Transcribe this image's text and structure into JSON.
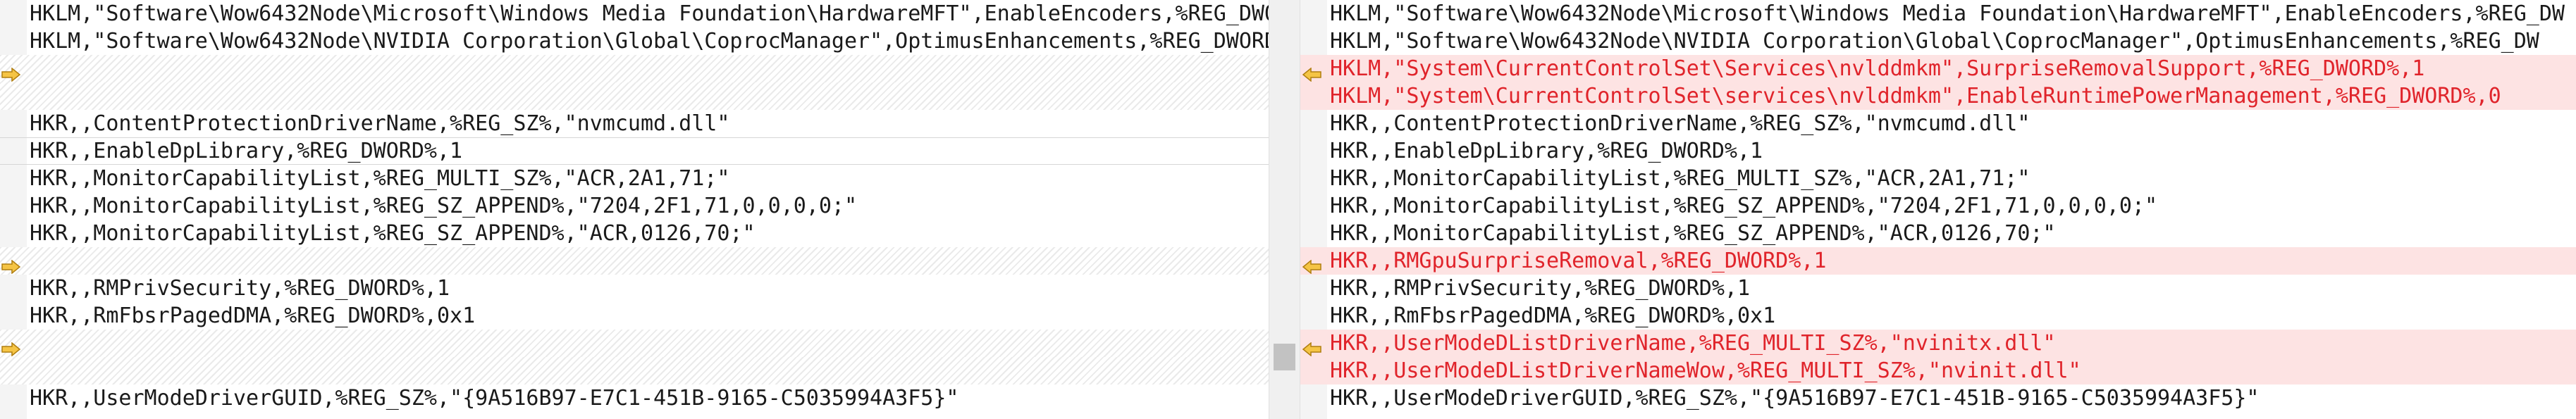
{
  "left_pane": {
    "lines": [
      {
        "kind": "text",
        "text": "HKLM,\"Software\\Wow6432Node\\Microsoft\\Windows Media Foundation\\HardwareMFT\",EnableEncoders,%REG_DWO"
      },
      {
        "kind": "text",
        "text": "HKLM,\"Software\\Wow6432Node\\NVIDIA Corporation\\Global\\CoprocManager\",OptimusEnhancements,%REG_DWORD"
      },
      {
        "kind": "placeholder",
        "text": ""
      },
      {
        "kind": "placeholder",
        "text": ""
      },
      {
        "kind": "text",
        "text": "HKR,,ContentProtectionDriverName,%REG_SZ%,\"nvmcumd.dll\""
      },
      {
        "kind": "text",
        "text": "HKR,,EnableDpLibrary,%REG_DWORD%,1"
      },
      {
        "kind": "text",
        "text": "HKR,,MonitorCapabilityList,%REG_MULTI_SZ%,\"ACR,2A1,71;\""
      },
      {
        "kind": "text",
        "text": "HKR,,MonitorCapabilityList,%REG_SZ_APPEND%,\"7204,2F1,71,0,0,0,0;\""
      },
      {
        "kind": "text",
        "text": "HKR,,MonitorCapabilityList,%REG_SZ_APPEND%,\"ACR,0126,70;\""
      },
      {
        "kind": "placeholder",
        "text": ""
      },
      {
        "kind": "text",
        "text": "HKR,,RMPrivSecurity,%REG_DWORD%,1"
      },
      {
        "kind": "text",
        "text": "HKR,,RmFbsrPagedDMA,%REG_DWORD%,0x1"
      },
      {
        "kind": "placeholder",
        "text": ""
      },
      {
        "kind": "placeholder",
        "text": ""
      },
      {
        "kind": "text",
        "text": "HKR,,UserModeDriverGUID,%REG_SZ%,\"{9A516B97-E7C1-451B-9165-C5035994A3F5}\""
      }
    ]
  },
  "right_pane": {
    "lines": [
      {
        "kind": "text",
        "text": "HKLM,\"Software\\Wow6432Node\\Microsoft\\Windows Media Foundation\\HardwareMFT\",EnableEncoders,%REG_DW"
      },
      {
        "kind": "text",
        "text": "HKLM,\"Software\\Wow6432Node\\NVIDIA Corporation\\Global\\CoprocManager\",OptimusEnhancements,%REG_DW"
      },
      {
        "kind": "added",
        "text": "HKLM,\"System\\CurrentControlSet\\Services\\nvlddmkm\",SurpriseRemovalSupport,%REG_DWORD%,1"
      },
      {
        "kind": "added",
        "text": "HKLM,\"System\\CurrentControlSet\\services\\nvlddmkm\",EnableRuntimePowerManagement,%REG_DWORD%,0"
      },
      {
        "kind": "text",
        "text": "HKR,,ContentProtectionDriverName,%REG_SZ%,\"nvmcumd.dll\""
      },
      {
        "kind": "text",
        "text": "HKR,,EnableDpLibrary,%REG_DWORD%,1"
      },
      {
        "kind": "text",
        "text": "HKR,,MonitorCapabilityList,%REG_MULTI_SZ%,\"ACR,2A1,71;\""
      },
      {
        "kind": "text",
        "text": "HKR,,MonitorCapabilityList,%REG_SZ_APPEND%,\"7204,2F1,71,0,0,0,0;\""
      },
      {
        "kind": "text",
        "text": "HKR,,MonitorCapabilityList,%REG_SZ_APPEND%,\"ACR,0126,70;\""
      },
      {
        "kind": "added",
        "text": "HKR,,RMGpuSurpriseRemoval,%REG_DWORD%,1"
      },
      {
        "kind": "text",
        "text": "HKR,,RMPrivSecurity,%REG_DWORD%,1"
      },
      {
        "kind": "text",
        "text": "HKR,,RmFbsrPagedDMA,%REG_DWORD%,0x1"
      },
      {
        "kind": "added",
        "text": "HKR,,UserModeDListDriverName,%REG_MULTI_SZ%,\"nvinitx.dll\""
      },
      {
        "kind": "added",
        "text": "HKR,,UserModeDListDriverNameWow,%REG_MULTI_SZ%,\"nvinit.dll\""
      },
      {
        "kind": "text",
        "text": "HKR,,UserModeDriverGUID,%REG_SZ%,\"{9A516B97-E7C1-451B-9165-C5035994A3F5}\""
      }
    ]
  },
  "colors": {
    "added_bg": "#fde3e3",
    "added_text": "#e0242b",
    "placeholder_stripe": "#eaeaea",
    "marker_fill": "#f5c445"
  },
  "icons": {
    "left_diff_marker": "arrow-right-icon",
    "right_diff_marker": "arrow-left-icon"
  }
}
